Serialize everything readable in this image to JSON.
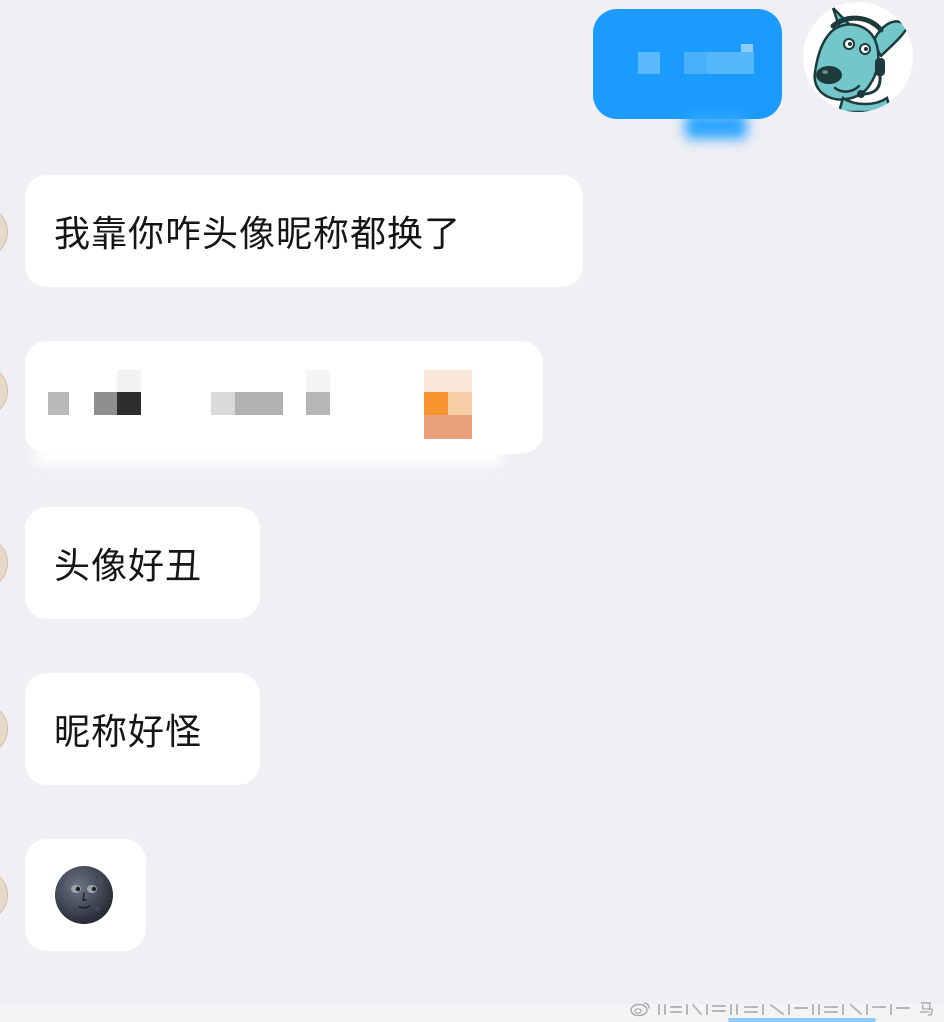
{
  "chat": {
    "messages": [
      {
        "direction": "outgoing",
        "content": ""
      },
      {
        "direction": "incoming",
        "content": "我靠你咋头像昵称都换了"
      },
      {
        "direction": "incoming",
        "content": ""
      },
      {
        "direction": "incoming",
        "content": "头像好丑"
      },
      {
        "direction": "incoming",
        "content": "昵称好怪"
      },
      {
        "direction": "incoming",
        "emoji": "🌚",
        "emoji_name": "new-moon-face"
      }
    ],
    "my_avatar_icon": "cartoon-dog-with-headset",
    "colors": {
      "background": "#efeff4",
      "outgoing_bubble": "#1b9bff",
      "incoming_bubble": "#ffffff",
      "text": "#151515",
      "avatar_dog": "#73c6c9"
    }
  },
  "watermark": {
    "text": "马",
    "icon": "weibo-icon"
  }
}
